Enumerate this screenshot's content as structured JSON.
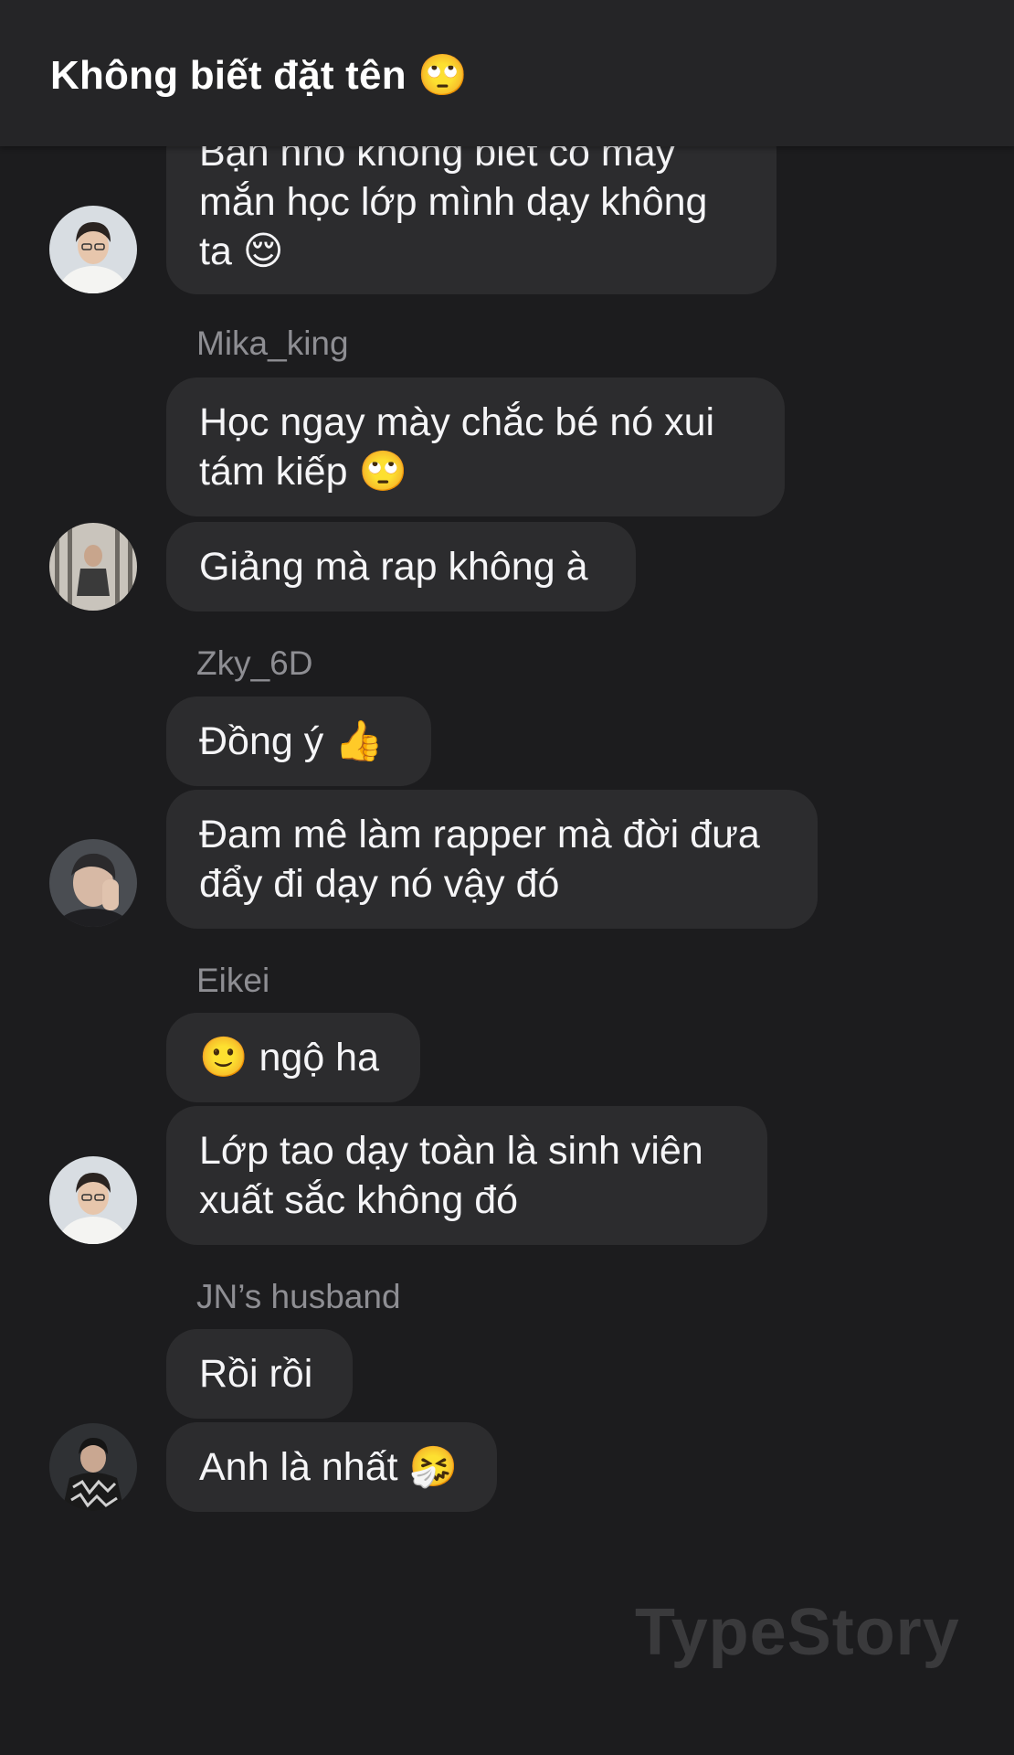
{
  "header": {
    "title": "Không biết đặt tên 🙄"
  },
  "messages": [
    {
      "text": "Bạn nhỏ không biết có may mắn học lớp mình dạy không ta 😌"
    },
    {
      "sender": "Mika_king",
      "text": "Học ngay mày chắc bé nó xui tám kiếp 🙄"
    },
    {
      "text": "Giảng mà rap không à"
    },
    {
      "sender": "Zky_6D",
      "text": "Đồng ý 👍"
    },
    {
      "text": "Đam mê làm rapper mà đời đưa đẩy đi dạy nó vậy đó"
    },
    {
      "sender": "Eikei",
      "text": "🙂 ngộ ha"
    },
    {
      "text": "Lớp tao dạy toàn là sinh viên xuất sắc không đó"
    },
    {
      "sender": "JN’s husband",
      "text": "Rồi rồi"
    },
    {
      "text": "Anh là nhất 🤧"
    }
  ],
  "avatars": [
    {
      "name": "avatar-user-1",
      "icon": "profile-photo-man-glasses-white-shirt"
    },
    {
      "name": "avatar-mika-king",
      "icon": "profile-photo-man-stairs"
    },
    {
      "name": "avatar-zky-6d",
      "icon": "profile-photo-man-hand-face"
    },
    {
      "name": "avatar-user-1-again",
      "icon": "profile-photo-man-glasses-white-shirt"
    },
    {
      "name": "avatar-jn-husband",
      "icon": "profile-photo-man-patterned-jacket"
    }
  ],
  "watermark": "TypeStory",
  "colors": {
    "background": "#1c1c1e",
    "header": "#252527",
    "bubble": "#2c2c2e",
    "sender": "#8e8e93",
    "watermark": "#3a3a3c"
  }
}
